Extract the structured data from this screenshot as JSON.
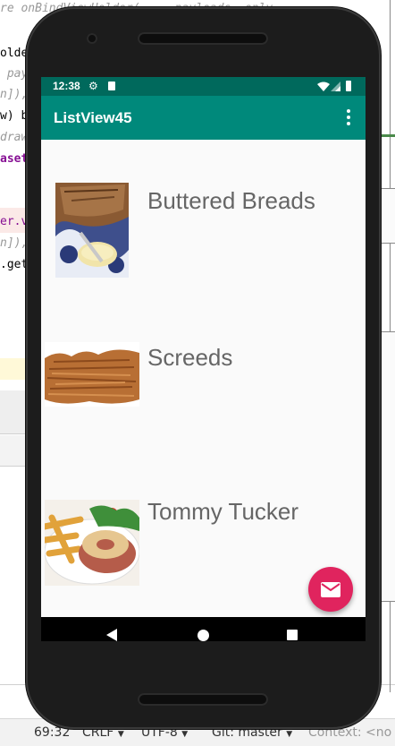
{
  "ide": {
    "code_lines": [
      {
        "text": "re onBindViewHolder(...  payloads  only",
        "color": "#999999",
        "italic": true
      },
      {
        "text": "olde",
        "color": "#000000",
        "italic": false
      },
      {
        "text": " pay",
        "color": "#999999",
        "italic": true
      },
      {
        "text": "n]),",
        "color": "#999999",
        "italic": true
      },
      {
        "text": "w) b",
        "color": "#000000",
        "italic": false
      },
      {
        "text": "draw",
        "color": "#999999",
        "italic": true
      },
      {
        "text": "aset",
        "color": "#871094",
        "italic": false
      },
      {
        "text": "er.v",
        "color": "#871094",
        "italic": false
      },
      {
        "text": "n]),",
        "color": "#999999",
        "italic": true
      },
      {
        "text": ".get",
        "color": "#000000",
        "italic": false
      }
    ],
    "status": {
      "position": "69:32",
      "line_sep": "CRLF",
      "encoding": "UTF-8",
      "vcs": "Git: master",
      "context": "Context: <no"
    }
  },
  "phone": {
    "status_bar": {
      "time": "12:38",
      "color": "#00695c"
    },
    "app_bar": {
      "title": "ListView45",
      "color": "#00897b"
    },
    "items": [
      {
        "label": "Buttered Breads"
      },
      {
        "label": "Screeds"
      },
      {
        "label": "Tommy Tucker"
      }
    ],
    "fab": {
      "icon": "mail-icon",
      "color": "#e0245e"
    },
    "nav_bar": {
      "back": "back-icon",
      "home": "home-icon",
      "recents": "recents-icon"
    }
  }
}
